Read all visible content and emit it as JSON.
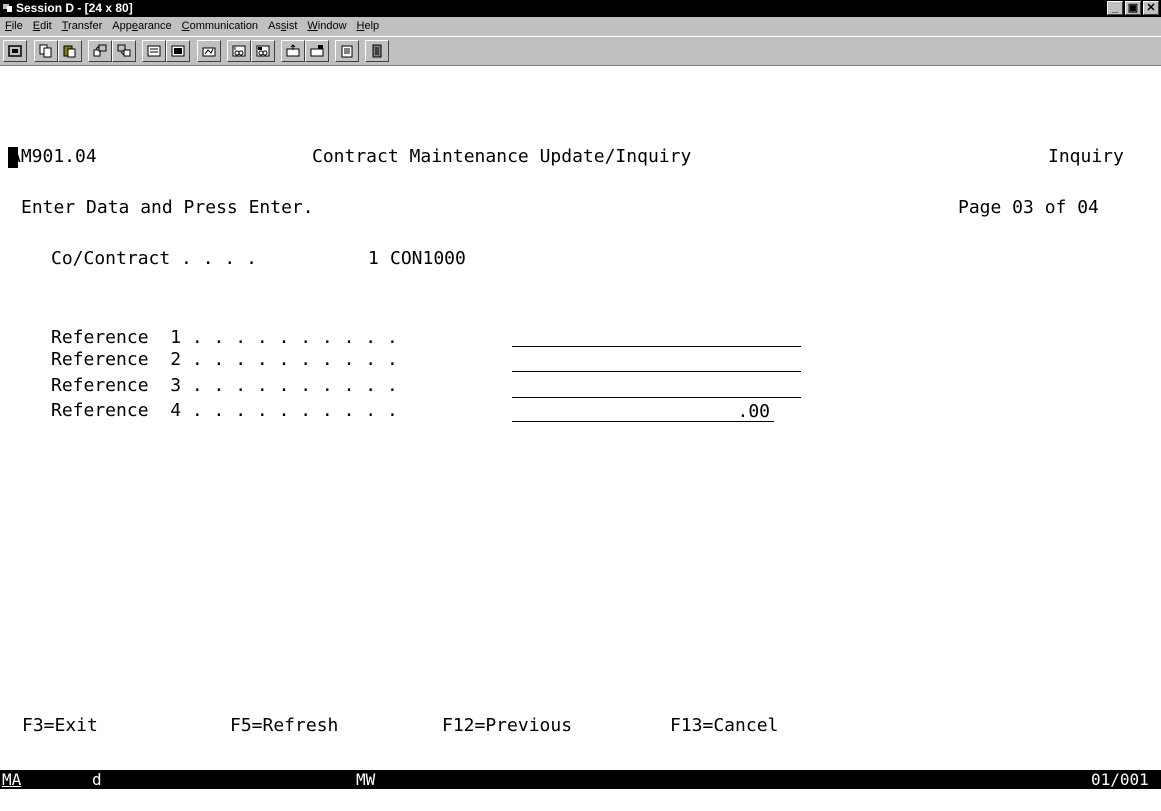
{
  "window": {
    "title": "Session D - [24 x 80]"
  },
  "menu": [
    {
      "pre": "",
      "ul": "F",
      "post": "ile"
    },
    {
      "pre": "",
      "ul": "E",
      "post": "dit"
    },
    {
      "pre": "",
      "ul": "T",
      "post": "ransfer"
    },
    {
      "pre": "App",
      "ul": "e",
      "post": "arance"
    },
    {
      "pre": "",
      "ul": "C",
      "post": "ommunication"
    },
    {
      "pre": "As",
      "ul": "s",
      "post": "ist"
    },
    {
      "pre": "",
      "ul": "W",
      "post": "indow"
    },
    {
      "pre": "",
      "ul": "H",
      "post": "elp"
    }
  ],
  "toolbar": {
    "icons": [
      "print-screen-icon",
      "copy-icon",
      "paste-icon",
      "send-file-icon",
      "receive-file-icon",
      "keypad-icon",
      "display-icon",
      "macro-icon",
      "record-icon",
      "play-icon",
      "start-icon",
      "stop-icon",
      "clipboard-icon",
      "exit-icon"
    ]
  },
  "screen": {
    "program_id": "AM901.04",
    "screen_title": "Contract Maintenance Update/Inquiry",
    "mode": "Inquiry",
    "instruction": "Enter Data and Press Enter.",
    "page": "Page 03 of 04",
    "co_contract_label": "Co/Contract . . . .",
    "co_value": "1",
    "contract_value": "CON1000",
    "references": [
      {
        "label": "Reference  1 . . . . . . . . . .",
        "value": ""
      },
      {
        "label": "Reference  2 . . . . . . . . . .",
        "value": ""
      },
      {
        "label": "Reference  3 . . . . . . . . . .",
        "value": ""
      },
      {
        "label": "Reference  4 . . . . . . . . . .",
        "value": ".00"
      }
    ],
    "fkeys": {
      "f3": "F3=Exit",
      "f5": "F5=Refresh",
      "f12": "F12=Previous",
      "f13": "F13=Cancel"
    }
  },
  "status": {
    "ma": "MA",
    "d": "d",
    "mw": "MW",
    "position": "01/001"
  }
}
